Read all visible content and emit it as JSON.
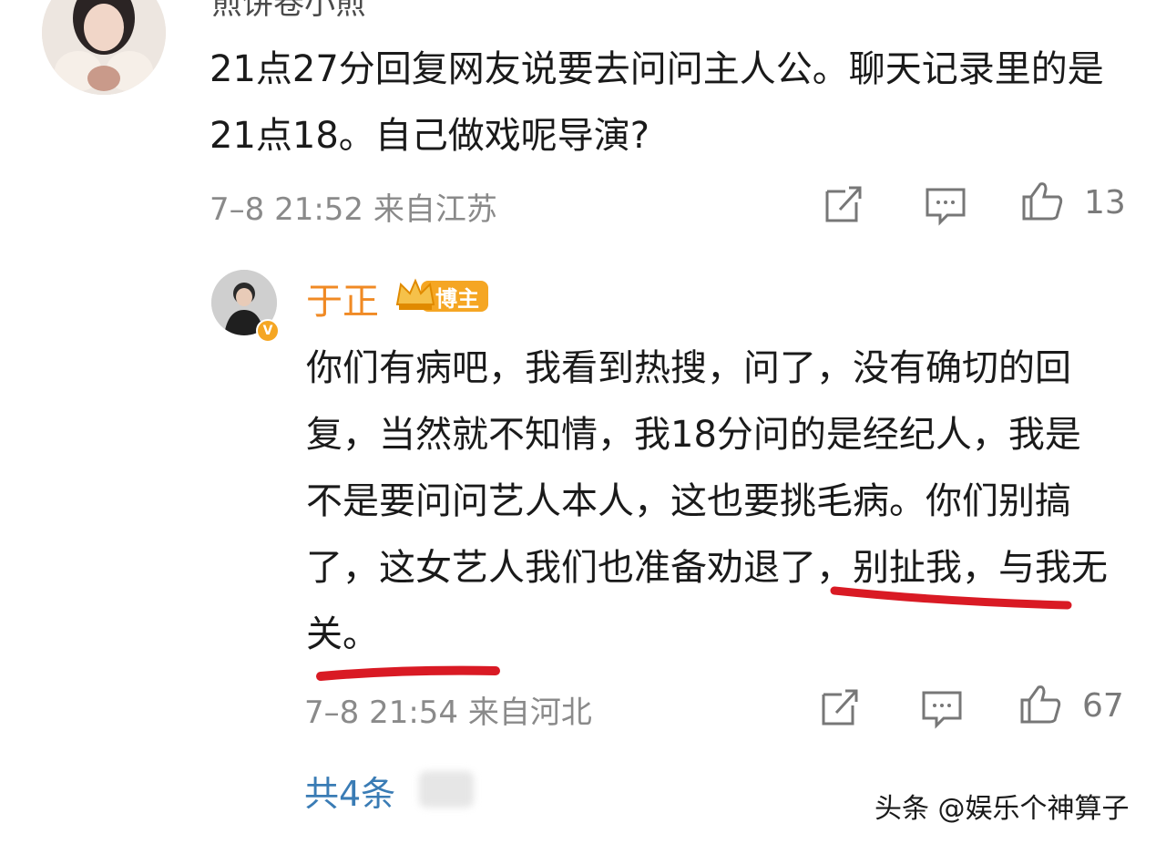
{
  "comment1": {
    "author_partial": "煎饼卷小煎",
    "text": "21点27分回复网友说要去问问主人公。聊天记录里的是21点18。自己做戏呢导演?",
    "meta": "7–8 21:52 来自江苏",
    "like_count": "13"
  },
  "reply": {
    "author": "于正",
    "badge": "博主",
    "text": "你们有病吧，我看到热搜，问了，没有确切的回复，当然就不知情，我18分问的是经纪人，我是不是要问问艺人本人，这也要挑毛病。你们别搞了，这女艺人我们也准备劝退了，别扯我，与我无关。",
    "meta": "7–8 21:54 来自河北",
    "like_count": "67",
    "highlight_color": "#d91a24"
  },
  "footer": {
    "replies_label": "共4条",
    "watermark": "头条 @娱乐个神算子"
  },
  "icons": [
    "share-icon",
    "comment-icon",
    "like-icon"
  ],
  "colors": {
    "name": "#f08a24",
    "meta": "#8a8a8a",
    "link": "#3a7cb5",
    "badge": "#f5a623"
  }
}
